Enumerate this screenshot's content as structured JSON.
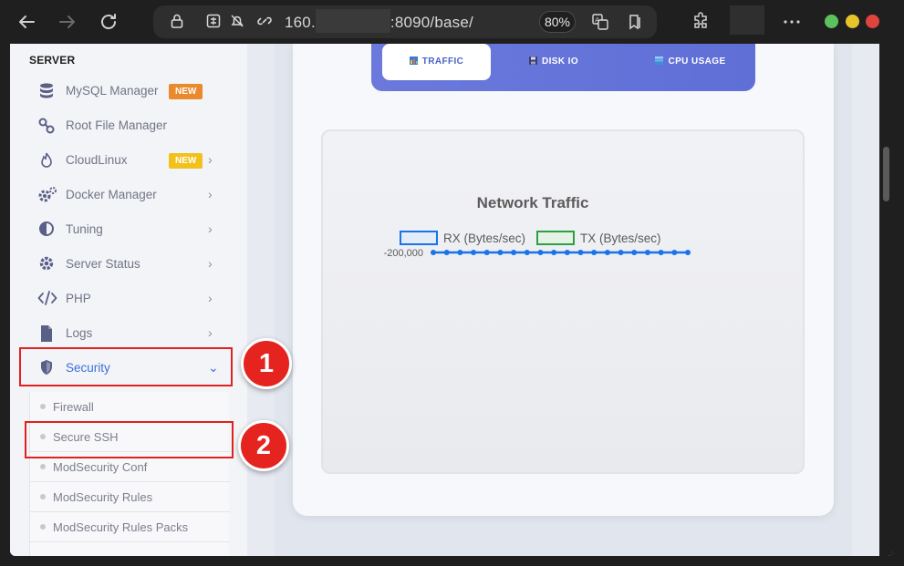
{
  "browser": {
    "url_prefix": "160.",
    "url_suffix": ":8090/base/",
    "zoom": "80%"
  },
  "sidebar": {
    "section_title": "SERVER",
    "items": [
      {
        "label": "MySQL Manager",
        "badge": "NEW"
      },
      {
        "label": "Root File Manager"
      },
      {
        "label": "CloudLinux",
        "badge": "NEW"
      },
      {
        "label": "Docker Manager"
      },
      {
        "label": "Tuning"
      },
      {
        "label": "Server Status"
      },
      {
        "label": "PHP"
      },
      {
        "label": "Logs"
      },
      {
        "label": "Security"
      }
    ],
    "security_submenu": [
      {
        "label": "Firewall"
      },
      {
        "label": "Secure SSH"
      },
      {
        "label": "ModSecurity Conf"
      },
      {
        "label": "ModSecurity Rules"
      },
      {
        "label": "ModSecurity Rules Packs"
      }
    ]
  },
  "annotations": {
    "step1": "1",
    "step2": "2",
    "highlight_color": "#e0211f"
  },
  "tabs": [
    {
      "label": "TRAFFIC",
      "active": true
    },
    {
      "label": "DISK IO",
      "active": false
    },
    {
      "label": "CPU USAGE",
      "active": false
    }
  ],
  "chart_data": {
    "type": "line",
    "title": "Network Traffic",
    "series": [
      {
        "name": "RX (Bytes/sec)",
        "color": "#1a73e8",
        "values": [
          -200000,
          -200000,
          -200000,
          -200000,
          -200000,
          -200000,
          -200000,
          -200000,
          -200000,
          -200000,
          -200000,
          -200000,
          -200000,
          -200000,
          -200000,
          -200000,
          -200000,
          -200000,
          -200000,
          -200000
        ]
      },
      {
        "name": "TX (Bytes/sec)",
        "color": "#2ea043",
        "values": []
      }
    ],
    "ytick_label": "-200,000",
    "legend_position": "top"
  },
  "colors": {
    "accent": "#5f6fd6",
    "link": "#3b6fd8",
    "badge_orange": "#e98a2c",
    "badge_yellow": "#f2c11c"
  }
}
